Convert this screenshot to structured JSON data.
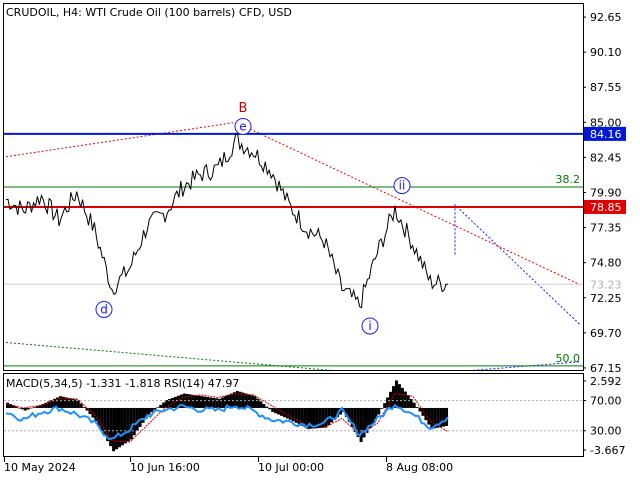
{
  "header": {
    "title": "CRUDOIL, H4:  WTI Crude Oil (100 barrels) CFD, USD"
  },
  "colors": {
    "background": "#ffffff",
    "border": "#000000",
    "price_line": "#000000",
    "resistance_blue": "#0018d8",
    "resistance_red": "#e00000",
    "fib_green": "#007a00",
    "wave_label_blue": "#1a1aff",
    "wave_label_red": "#c80000",
    "current_price": "#b0b0b0",
    "macd_hist": "#000000",
    "macd_signal": "#d00000",
    "rsi": "#1e90ff"
  },
  "chart_data": [
    {
      "type": "line",
      "name": "price",
      "symbol": "CRUDOIL",
      "timeframe": "H4",
      "ylim": [
        67.0,
        93.6
      ],
      "y_ticks": [
        "92.65",
        "90.10",
        "87.55",
        "85.00",
        "82.45",
        "79.90",
        "77.35",
        "74.80",
        "72.25",
        "69.70",
        "67.15"
      ],
      "x_ticks": [
        "10 May 2024",
        "10 Jun 16:00",
        "10 Jul 00:00",
        "8 Aug 08:00"
      ],
      "x": [
        "10 May 2024",
        "~15 May",
        "~20 May",
        "~24 May",
        "~29 May",
        "~03 Jun",
        "~07 Jun",
        "10 Jun 16:00",
        "~14 Jun",
        "~19 Jun",
        "~24 Jun",
        "~28 Jun",
        "~03 Jul",
        "~05 Jul",
        "10 Jul 00:00",
        "~12 Jul",
        "~17 Jul",
        "~22 Jul",
        "~26 Jul",
        "~31 Jul",
        "~05 Aug",
        "8 Aug 08:00",
        "~12 Aug",
        "~16 Aug",
        "~20 Aug",
        "~23 Aug"
      ],
      "values": [
        79.4,
        78.6,
        79.6,
        77.9,
        79.9,
        77.2,
        72.9,
        74.4,
        77.5,
        78.4,
        80.3,
        81.2,
        81.7,
        83.7,
        82.9,
        81.5,
        79.0,
        77.3,
        76.4,
        72.9,
        71.7,
        75.5,
        78.7,
        76.2,
        73.4,
        73.23
      ],
      "levels": [
        {
          "label": "84.16",
          "value": 84.16,
          "style": "blue-horizontal"
        },
        {
          "label": "78.85",
          "value": 78.85,
          "style": "red-horizontal"
        },
        {
          "label": "38.2",
          "value": 80.3,
          "style": "green-fib"
        },
        {
          "label": "50.0",
          "value": 67.3,
          "style": "green-fib"
        }
      ],
      "current_price": {
        "label": "73.23",
        "value": 73.23
      },
      "wave_labels": [
        {
          "text": "B",
          "x": "~05 Jul",
          "value": 85.3
        },
        {
          "text": "e",
          "x": "~05 Jul",
          "value": 84.7
        },
        {
          "text": "d",
          "x": "~05 Jun",
          "value": 71.4
        },
        {
          "text": "i",
          "x": "~03 Aug",
          "value": 70.2
        },
        {
          "text": "ii",
          "x": "~09 Aug",
          "value": 80.4
        }
      ],
      "trendlines": [
        {
          "style": "red-dotted",
          "from": {
            "x": "10 May 2024",
            "value": 82.5
          },
          "via": {
            "x": "~05 Jul",
            "value": 85.0
          },
          "to": {
            "x": "~26 Aug",
            "value": 73.2
          }
        },
        {
          "style": "blue-dotted",
          "from": {
            "x": "~06 Aug",
            "value": 75.4
          },
          "via": {
            "x": "~09 Aug",
            "value": 79.0
          },
          "to": {
            "x": "~26 Aug",
            "value": 70.3
          }
        },
        {
          "style": "green-dotted",
          "from": {
            "x": "10 May 2024",
            "value": 69.0
          },
          "to": {
            "x": "~24 Jul",
            "value": 66.2
          }
        },
        {
          "style": "blue-dotted",
          "from": {
            "x": "~31 Jul",
            "value": 66.2
          },
          "to": {
            "x": "~26 Aug",
            "value": 67.6
          }
        }
      ],
      "grid": false
    },
    {
      "type": "bar",
      "name": "indicators",
      "title": "MACD(5,34,5) -1.331 -1.818 RSI(14) 47.97",
      "y_ticks": [
        "2.592",
        "70.00",
        "30.00",
        "-3.667"
      ],
      "ylim": [
        -3.667,
        2.592
      ],
      "x": [
        "10 May 2024",
        "~15 May",
        "~20 May",
        "~24 May",
        "~29 May",
        "~03 Jun",
        "~07 Jun",
        "10 Jun 16:00",
        "~14 Jun",
        "~19 Jun",
        "~24 Jun",
        "~28 Jun",
        "~03 Jul",
        "~05 Jul",
        "10 Jul 00:00",
        "~12 Jul",
        "~17 Jul",
        "~22 Jul",
        "~26 Jul",
        "~31 Jul",
        "~05 Aug",
        "8 Aug 08:00",
        "~12 Aug",
        "~16 Aug",
        "~20 Aug",
        "~23 Aug"
      ],
      "series": [
        {
          "name": "MACD",
          "values": [
            0.4,
            -0.2,
            0.3,
            0.9,
            0.6,
            -1.0,
            -3.3,
            -2.4,
            -0.5,
            0.6,
            1.1,
            0.9,
            0.7,
            1.3,
            0.9,
            -0.3,
            -0.9,
            -1.6,
            -1.5,
            -0.3,
            -2.6,
            -0.5,
            2.1,
            0.4,
            -1.6,
            -1.33
          ]
        },
        {
          "name": "Signal",
          "values": [
            0.3,
            0.0,
            0.2,
            0.7,
            0.7,
            -0.5,
            -2.5,
            -2.6,
            -1.3,
            0.0,
            0.8,
            1.0,
            0.8,
            1.1,
            1.0,
            0.2,
            -0.6,
            -1.3,
            -1.5,
            -0.8,
            -2.0,
            -1.2,
            1.1,
            0.9,
            -1.0,
            -1.82
          ]
        },
        {
          "name": "RSI",
          "values": [
            55,
            45,
            55,
            60,
            52,
            40,
            18,
            32,
            50,
            58,
            62,
            58,
            57,
            64,
            56,
            45,
            42,
            38,
            40,
            56,
            25,
            45,
            66,
            52,
            35,
            47.97
          ]
        }
      ],
      "levels": [
        {
          "label": "70.00",
          "value": 70
        },
        {
          "label": "30.00",
          "value": 30
        }
      ]
    }
  ]
}
